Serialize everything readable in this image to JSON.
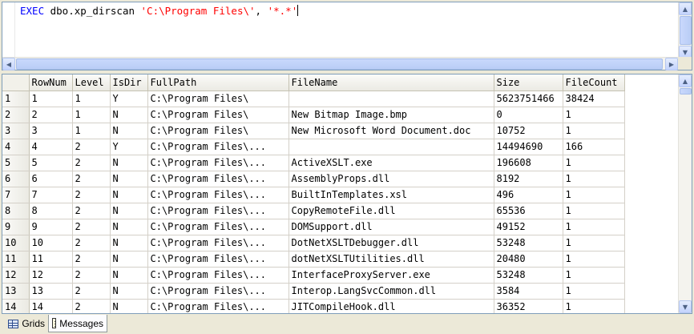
{
  "editor": {
    "keyword": "EXEC",
    "proc": " dbo.xp_dirscan ",
    "arg1": "'C:\\Program Files\\'",
    "sep": ", ",
    "arg2": "'*.*'"
  },
  "grid": {
    "columns": [
      "RowNum",
      "Level",
      "IsDir",
      "FullPath",
      "FileName",
      "Size",
      "FileCount"
    ],
    "rows": [
      {
        "n": "1",
        "c": [
          "1",
          "1",
          "Y",
          "C:\\Program Files\\",
          "",
          "5623751466",
          "38424"
        ]
      },
      {
        "n": "2",
        "c": [
          "2",
          "1",
          "N",
          "C:\\Program Files\\",
          "New Bitmap Image.bmp",
          "0",
          "1"
        ]
      },
      {
        "n": "3",
        "c": [
          "3",
          "1",
          "N",
          "C:\\Program Files\\",
          "New Microsoft Word Document.doc",
          "10752",
          "1"
        ]
      },
      {
        "n": "4",
        "c": [
          "4",
          "2",
          "Y",
          "C:\\Program Files\\...",
          "",
          "14494690",
          "166"
        ]
      },
      {
        "n": "5",
        "c": [
          "5",
          "2",
          "N",
          "C:\\Program Files\\...",
          "ActiveXSLT.exe",
          "196608",
          "1"
        ]
      },
      {
        "n": "6",
        "c": [
          "6",
          "2",
          "N",
          "C:\\Program Files\\...",
          "AssemblyProps.dll",
          "8192",
          "1"
        ]
      },
      {
        "n": "7",
        "c": [
          "7",
          "2",
          "N",
          "C:\\Program Files\\...",
          "BuiltInTemplates.xsl",
          "496",
          "1"
        ]
      },
      {
        "n": "8",
        "c": [
          "8",
          "2",
          "N",
          "C:\\Program Files\\...",
          "CopyRemoteFile.dll",
          "65536",
          "1"
        ]
      },
      {
        "n": "9",
        "c": [
          "9",
          "2",
          "N",
          "C:\\Program Files\\...",
          "DOMSupport.dll",
          "49152",
          "1"
        ]
      },
      {
        "n": "10",
        "c": [
          "10",
          "2",
          "N",
          "C:\\Program Files\\...",
          "DotNetXSLTDebugger.dll",
          "53248",
          "1"
        ]
      },
      {
        "n": "11",
        "c": [
          "11",
          "2",
          "N",
          "C:\\Program Files\\...",
          "dotNetXSLTUtilities.dll",
          "20480",
          "1"
        ]
      },
      {
        "n": "12",
        "c": [
          "12",
          "2",
          "N",
          "C:\\Program Files\\...",
          "InterfaceProxyServer.exe",
          "53248",
          "1"
        ]
      },
      {
        "n": "13",
        "c": [
          "13",
          "2",
          "N",
          "C:\\Program Files\\...",
          "Interop.LangSvcCommon.dll",
          "3584",
          "1"
        ]
      },
      {
        "n": "14",
        "c": [
          "14",
          "2",
          "N",
          "C:\\Program Files\\...",
          "JITCompileHook.dll",
          "36352",
          "1"
        ]
      }
    ]
  },
  "tabs": {
    "grids_label": "Grids",
    "messages_label": "Messages"
  },
  "icons": {
    "scroll_up": "up-arrow-icon",
    "scroll_down": "down-arrow-icon",
    "scroll_left": "left-arrow-icon",
    "scroll_right": "right-arrow-icon",
    "grids": "grid-icon",
    "messages": "messages-icon"
  }
}
